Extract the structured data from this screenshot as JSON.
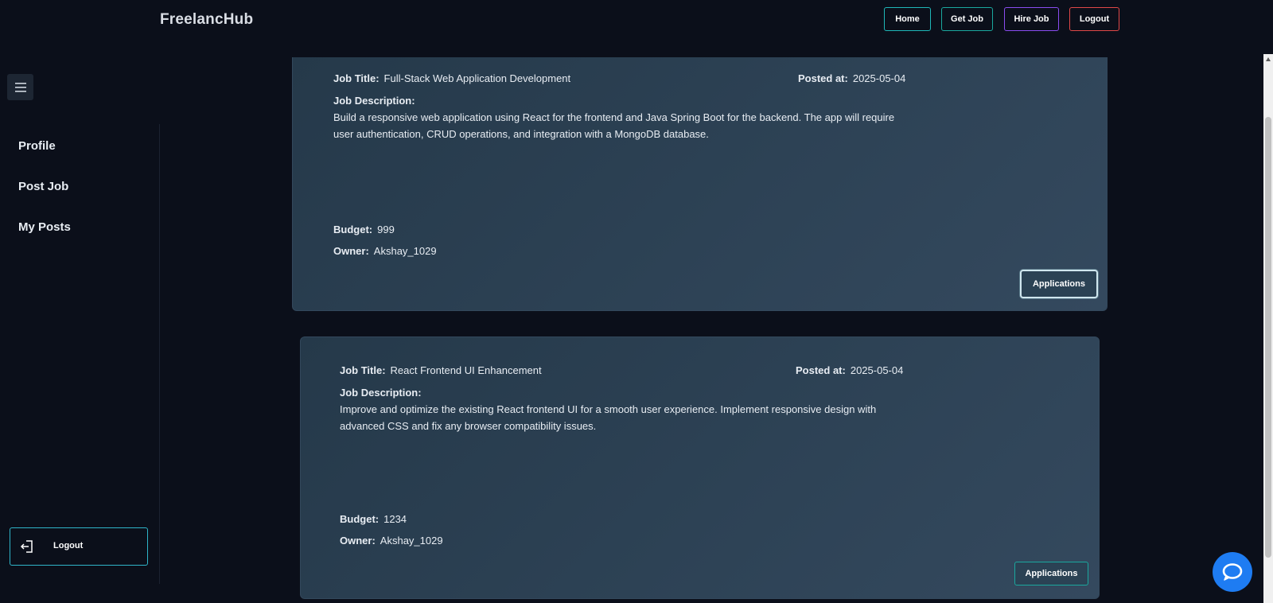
{
  "brand": "FreelancHub",
  "topnav": {
    "home": "Home",
    "get_job": "Get Job",
    "hire_job": "Hire Job",
    "logout": "Logout"
  },
  "sidebar": {
    "toggle_icon": "hamburger-menu-icon",
    "items": [
      {
        "label": "Profile"
      },
      {
        "label": "Post Job"
      },
      {
        "label": "My Posts"
      }
    ],
    "logout_label": "Logout",
    "logout_icon": "logout-icon"
  },
  "labels": {
    "job_title": "Job Title:",
    "posted_at": "Posted at:",
    "job_description": "Job Description:",
    "budget": "Budget:",
    "owner": "Owner:"
  },
  "jobs": [
    {
      "title": "Full-Stack Web Application Development",
      "posted_at": "2025-05-04",
      "description": "Build a responsive web application using React for the frontend and Java Spring Boot for the backend. The app will require user authentication, CRUD operations, and integration with a MongoDB database.",
      "budget": "999",
      "owner": "Akshay_1029",
      "button": "Applications"
    },
    {
      "title": "React Frontend UI Enhancement",
      "posted_at": "2025-05-04",
      "description": "Improve and optimize the existing React frontend UI for a smooth user experience. Implement responsive design with advanced CSS and fix any browser compatibility issues.",
      "budget": "1234",
      "owner": "Akshay_1029",
      "button": "Applications"
    }
  ],
  "colors": {
    "background": "#0b0f1a",
    "card": "#2d4255",
    "accent_teal": "#1fb8b8",
    "accent_purple": "#8a4cf0",
    "accent_red": "#e04848",
    "chat_blue": "#1e7cf2"
  },
  "chat_icon": "chat-bubble-icon"
}
